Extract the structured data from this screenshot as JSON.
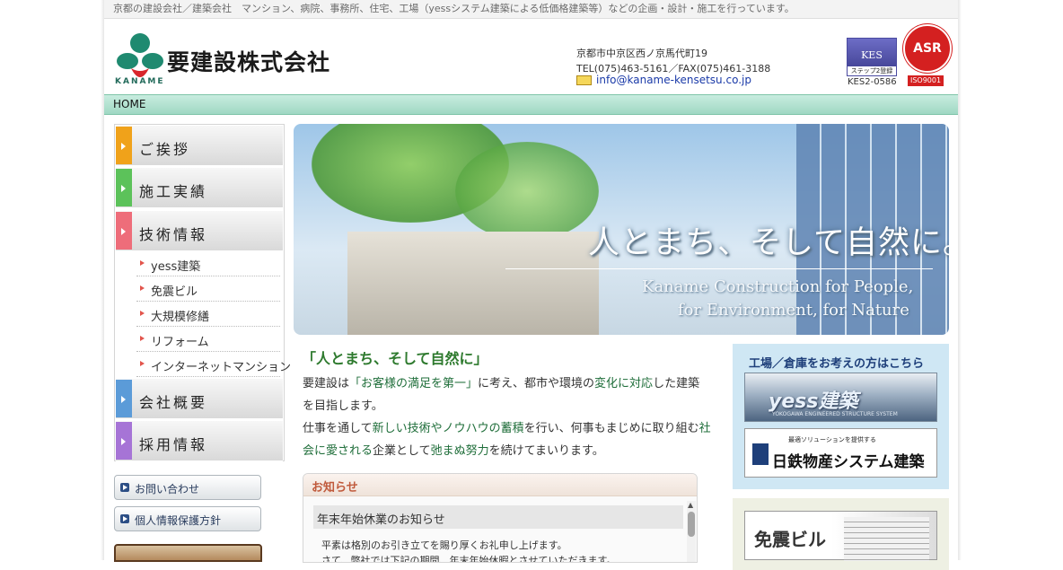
{
  "top_bar": {
    "text": "京都の建設会社／建築会社　マンション、病院、事務所、住宅、工場（yessシステム建築による低価格建築等）などの企画・設計・施工を行っています。"
  },
  "header": {
    "company_name": "要建設株式会社",
    "logo_sub": "KANAME",
    "address_line1": "京都市中京区西ノ京馬代町19",
    "address_line2": "TEL(075)463-5161／FAX(075)461-3188",
    "email": "info@kaname-kensetsu.co.jp",
    "kes_badge": "KES",
    "kes_step": "ステップ2登録",
    "kes_code": "KES2-0586",
    "asr_badge": "ASR",
    "iso_label": "ISO9001"
  },
  "nav": {
    "home": "HOME"
  },
  "sidebar": {
    "menu": [
      {
        "label": "ご挨拶",
        "color": "#f0a21a"
      },
      {
        "label": "施工実績",
        "color": "#5cc25a"
      },
      {
        "label": "技術情報",
        "color": "#ee6d7a"
      },
      {
        "label": "会社概要",
        "color": "#5b9bd8"
      },
      {
        "label": "採用情報",
        "color": "#a674d6"
      }
    ],
    "sub_items": [
      "yess建築",
      "免震ビル",
      "大規模修繕",
      "リフォーム",
      "インターネットマンション"
    ],
    "links": [
      "お問い合わせ",
      "個人情報保護方針"
    ]
  },
  "hero": {
    "catchcopy": "人とまち、そして自然に。",
    "english_line1": "Kaname Construction for People,",
    "english_line2": "for Environment, for Nature"
  },
  "intro": {
    "heading": "「人とまち、そして自然に」",
    "p1_a": "要建設は",
    "p1_b": "「お客様の満足を第一」",
    "p1_c": "に考え、都市や環境の",
    "p1_d": "変化に対応",
    "p1_e": "した建築",
    "p2": "を目指します。",
    "p3_a": "仕事を通して",
    "p3_b": "新しい技術やノウハウの蓄積",
    "p3_c": "を行い、何事もまじめに取り組む",
    "p3_d": "社",
    "p4_a": "会に愛される",
    "p4_b": "企業として",
    "p4_c": "弛まぬ努力",
    "p4_d": "を続けてまいります。"
  },
  "news": {
    "title": "お知らせ",
    "item_title": "年末年始休業のお知らせ",
    "text1": "平素は格別のお引き立てを賜り厚くお礼申し上げます。",
    "text2": "さて、弊社では下記の期間、年末年始休暇とさせていただきます。"
  },
  "promo": {
    "factory_heading": "工場／倉庫をお考えの方はこちら",
    "yess_logo": "yess建築",
    "yess_sub": "YOKOGAWA ENGINEERED STRUCTURE SYSTEM",
    "nittetsu_small": "最適ソリューションを提供する",
    "nittetsu_name": "日鉄物産システム建築",
    "menshin": "免震ビル"
  }
}
